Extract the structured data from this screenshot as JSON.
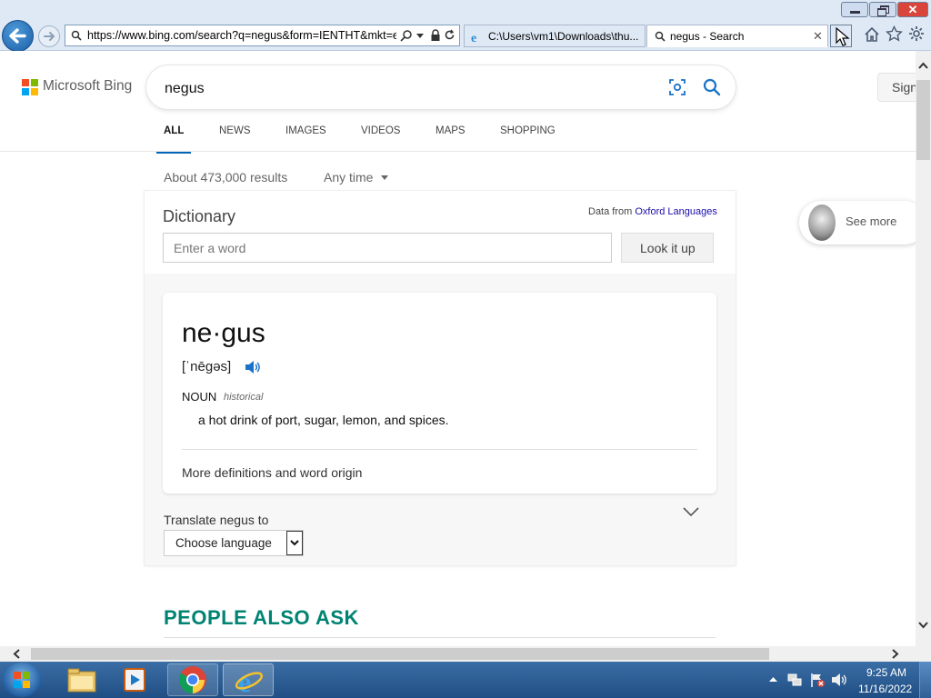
{
  "browser": {
    "address_url": "https://www.bing.com/search?q=negus&form=IENTHT&mkt=e",
    "tabs": [
      {
        "label": "C:\\Users\\vm1\\Downloads\\thu..."
      },
      {
        "label": "negus - Search"
      }
    ],
    "icons": [
      "back-icon",
      "forward-icon",
      "search-icon",
      "lock-icon",
      "refresh-icon",
      "home-icon",
      "favorites-icon",
      "gear-icon"
    ]
  },
  "bing": {
    "logo_text": "Microsoft Bing",
    "query": "negus",
    "sign_in": "Sign",
    "nav": [
      "ALL",
      "NEWS",
      "IMAGES",
      "VIDEOS",
      "MAPS",
      "SHOPPING"
    ],
    "active_nav": "ALL",
    "results_count": "About 473,000 results",
    "time_filter": "Any time",
    "side_see_more": "See more"
  },
  "dictionary": {
    "title": "Dictionary",
    "source_prefix": "Data from",
    "source_link": "Oxford Languages",
    "input_placeholder": "Enter a word",
    "lookup_button": "Look it up",
    "word": "ne·gus",
    "pronunciation": "[ˈnēɡəs]",
    "pos": "NOUN",
    "label": "historical",
    "definition": "a hot drink of port, sugar, lemon, and spices.",
    "more": "More definitions and word origin",
    "translate_label": "Translate negus to",
    "translate_select": "Choose language"
  },
  "people_also_ask": "PEOPLE ALSO ASK",
  "taskbar": {
    "time": "9:25 AM",
    "date": "11/16/2022"
  },
  "colors": {
    "bing_accent": "#0067b8",
    "ask_heading": "#008373",
    "link": "#1a0dab"
  }
}
